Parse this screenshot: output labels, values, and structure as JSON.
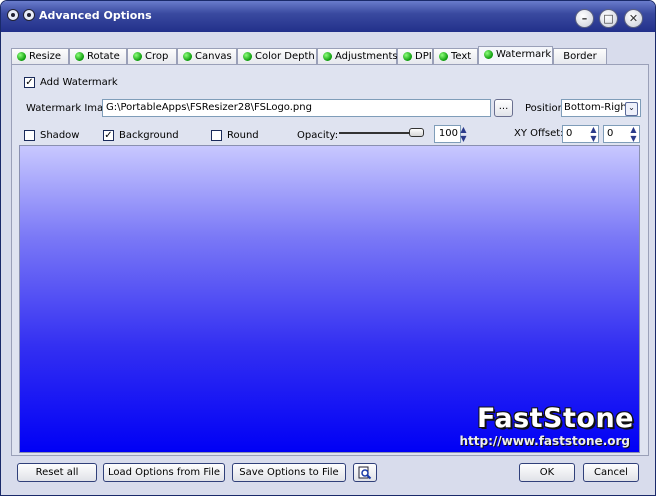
{
  "window": {
    "title": "Advanced Options"
  },
  "tabs": [
    {
      "label": "Resize"
    },
    {
      "label": "Rotate"
    },
    {
      "label": "Crop"
    },
    {
      "label": "Canvas"
    },
    {
      "label": "Color Depth"
    },
    {
      "label": "Adjustments"
    },
    {
      "label": "DPI"
    },
    {
      "label": "Text"
    },
    {
      "label": "Watermark",
      "active": true
    },
    {
      "label": "Border"
    }
  ],
  "watermark": {
    "add_label": "Add Watermark",
    "add_checked": true,
    "image_label": "Watermark Image:",
    "image_path": "G:\\PortableApps\\FSResizer28\\FSLogo.png",
    "browse_label": "...",
    "position_label": "Position:",
    "position_value": "Bottom-Right",
    "shadow_label": "Shadow",
    "shadow_checked": false,
    "background_label": "Background",
    "background_checked": true,
    "round_label": "Round",
    "round_checked": false,
    "opacity_label": "Opacity:",
    "opacity_value": "100",
    "xy_label": "XY Offset:",
    "x_value": "0",
    "y_value": "0"
  },
  "preview": {
    "logo_text": "FastStone",
    "logo_url": "http://www.faststone.org"
  },
  "buttons": {
    "reset": "Reset all",
    "load": "Load Options from File",
    "save": "Save Options to File",
    "ok": "OK",
    "cancel": "Cancel"
  },
  "icons": {
    "preview": "magnifier-icon",
    "check": "✓",
    "spin_up": "▲",
    "spin_down": "▼",
    "dropdown": "⌄"
  },
  "colors": {
    "tab_status": "#12b012",
    "title_bar": "#2a3a96",
    "preview_top": "#c8c8ff",
    "preview_bottom": "#0000f5"
  }
}
